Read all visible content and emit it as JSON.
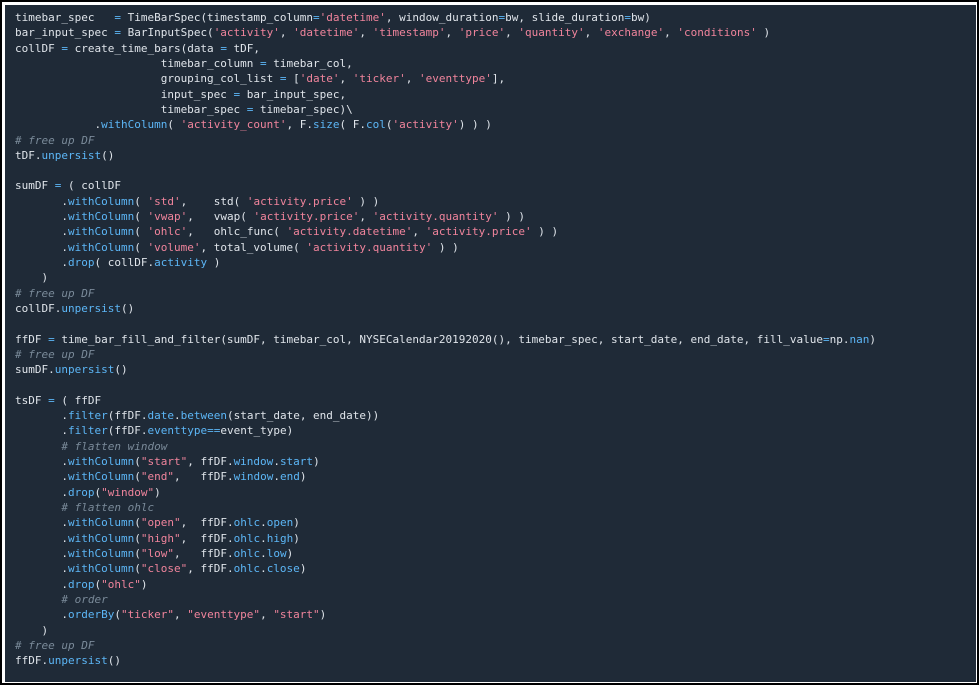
{
  "colors": {
    "background": "#1f2a37",
    "text": "#dfe4ea",
    "string": "#f0849c",
    "comment": "#7a8a99",
    "method": "#5cb6f6"
  },
  "code_lines": [
    [
      [
        "d",
        "timebar_spec   "
      ],
      [
        "o",
        "="
      ],
      [
        "d",
        " TimeBarSpec(timestamp_column"
      ],
      [
        "o",
        "="
      ],
      [
        "s",
        "'datetime'"
      ],
      [
        "d",
        ", window_duration"
      ],
      [
        "o",
        "="
      ],
      [
        "d",
        "bw, slide_duration"
      ],
      [
        "o",
        "="
      ],
      [
        "d",
        "bw)"
      ]
    ],
    [
      [
        "d",
        "bar_input_spec "
      ],
      [
        "o",
        "="
      ],
      [
        "d",
        " BarInputSpec("
      ],
      [
        "s",
        "'activity'"
      ],
      [
        "d",
        ", "
      ],
      [
        "s",
        "'datetime'"
      ],
      [
        "d",
        ", "
      ],
      [
        "s",
        "'timestamp'"
      ],
      [
        "d",
        ", "
      ],
      [
        "s",
        "'price'"
      ],
      [
        "d",
        ", "
      ],
      [
        "s",
        "'quantity'"
      ],
      [
        "d",
        ", "
      ],
      [
        "s",
        "'exchange'"
      ],
      [
        "d",
        ", "
      ],
      [
        "s",
        "'conditions'"
      ],
      [
        "d",
        " )"
      ]
    ],
    [
      [
        "d",
        "collDF "
      ],
      [
        "o",
        "="
      ],
      [
        "d",
        " create_time_bars(data "
      ],
      [
        "o",
        "="
      ],
      [
        "d",
        " tDF,"
      ]
    ],
    [
      [
        "d",
        "                      timebar_column "
      ],
      [
        "o",
        "="
      ],
      [
        "d",
        " timebar_col,"
      ]
    ],
    [
      [
        "d",
        "                      grouping_col_list "
      ],
      [
        "o",
        "="
      ],
      [
        "d",
        " ["
      ],
      [
        "s",
        "'date'"
      ],
      [
        "d",
        ", "
      ],
      [
        "s",
        "'ticker'"
      ],
      [
        "d",
        ", "
      ],
      [
        "s",
        "'eventtype'"
      ],
      [
        "d",
        "],"
      ]
    ],
    [
      [
        "d",
        "                      input_spec "
      ],
      [
        "o",
        "="
      ],
      [
        "d",
        " bar_input_spec,"
      ]
    ],
    [
      [
        "d",
        "                      timebar_spec "
      ],
      [
        "o",
        "="
      ],
      [
        "d",
        " timebar_spec)\\"
      ]
    ],
    [
      [
        "d",
        "            ."
      ],
      [
        "m",
        "withColumn"
      ],
      [
        "d",
        "( "
      ],
      [
        "s",
        "'activity_count'"
      ],
      [
        "d",
        ", F."
      ],
      [
        "m",
        "size"
      ],
      [
        "d",
        "( F."
      ],
      [
        "m",
        "col"
      ],
      [
        "d",
        "("
      ],
      [
        "s",
        "'activity'"
      ],
      [
        "d",
        ") ) )"
      ]
    ],
    [
      [
        "c",
        "# free up DF"
      ]
    ],
    [
      [
        "d",
        "tDF."
      ],
      [
        "m",
        "unpersist"
      ],
      [
        "d",
        "()"
      ]
    ],
    [
      [
        "d",
        ""
      ]
    ],
    [
      [
        "d",
        "sumDF "
      ],
      [
        "o",
        "="
      ],
      [
        "d",
        " ( collDF"
      ]
    ],
    [
      [
        "d",
        "       ."
      ],
      [
        "m",
        "withColumn"
      ],
      [
        "d",
        "( "
      ],
      [
        "s",
        "'std'"
      ],
      [
        "d",
        ",    std( "
      ],
      [
        "s",
        "'activity.price'"
      ],
      [
        "d",
        " ) )"
      ]
    ],
    [
      [
        "d",
        "       ."
      ],
      [
        "m",
        "withColumn"
      ],
      [
        "d",
        "( "
      ],
      [
        "s",
        "'vwap'"
      ],
      [
        "d",
        ",   vwap( "
      ],
      [
        "s",
        "'activity.price'"
      ],
      [
        "d",
        ", "
      ],
      [
        "s",
        "'activity.quantity'"
      ],
      [
        "d",
        " ) )"
      ]
    ],
    [
      [
        "d",
        "       ."
      ],
      [
        "m",
        "withColumn"
      ],
      [
        "d",
        "( "
      ],
      [
        "s",
        "'ohlc'"
      ],
      [
        "d",
        ",   ohlc_func( "
      ],
      [
        "s",
        "'activity.datetime'"
      ],
      [
        "d",
        ", "
      ],
      [
        "s",
        "'activity.price'"
      ],
      [
        "d",
        " ) )"
      ]
    ],
    [
      [
        "d",
        "       ."
      ],
      [
        "m",
        "withColumn"
      ],
      [
        "d",
        "( "
      ],
      [
        "s",
        "'volume'"
      ],
      [
        "d",
        ", total_volume( "
      ],
      [
        "s",
        "'activity.quantity'"
      ],
      [
        "d",
        " ) )"
      ]
    ],
    [
      [
        "d",
        "       ."
      ],
      [
        "m",
        "drop"
      ],
      [
        "d",
        "( collDF."
      ],
      [
        "m",
        "activity"
      ],
      [
        "d",
        " )"
      ]
    ],
    [
      [
        "d",
        "    )"
      ]
    ],
    [
      [
        "c",
        "# free up DF"
      ]
    ],
    [
      [
        "d",
        "collDF."
      ],
      [
        "m",
        "unpersist"
      ],
      [
        "d",
        "()"
      ]
    ],
    [
      [
        "d",
        ""
      ]
    ],
    [
      [
        "d",
        "ffDF "
      ],
      [
        "o",
        "="
      ],
      [
        "d",
        " time_bar_fill_and_filter(sumDF, timebar_col, NYSECalendar20192020(), timebar_spec, start_date, end_date, fill_value"
      ],
      [
        "o",
        "="
      ],
      [
        "d",
        "np."
      ],
      [
        "m",
        "nan"
      ],
      [
        "d",
        ")"
      ]
    ],
    [
      [
        "c",
        "# free up DF"
      ]
    ],
    [
      [
        "d",
        "sumDF."
      ],
      [
        "m",
        "unpersist"
      ],
      [
        "d",
        "()"
      ]
    ],
    [
      [
        "d",
        ""
      ]
    ],
    [
      [
        "d",
        "tsDF "
      ],
      [
        "o",
        "="
      ],
      [
        "d",
        " ( ffDF"
      ]
    ],
    [
      [
        "d",
        "       ."
      ],
      [
        "m",
        "filter"
      ],
      [
        "d",
        "(ffDF."
      ],
      [
        "m",
        "date"
      ],
      [
        "d",
        "."
      ],
      [
        "m",
        "between"
      ],
      [
        "d",
        "(start_date, end_date))"
      ]
    ],
    [
      [
        "d",
        "       ."
      ],
      [
        "m",
        "filter"
      ],
      [
        "d",
        "(ffDF."
      ],
      [
        "m",
        "eventtype"
      ],
      [
        "o",
        "=="
      ],
      [
        "d",
        "event_type)"
      ]
    ],
    [
      [
        "c",
        "       # flatten window"
      ]
    ],
    [
      [
        "d",
        "       ."
      ],
      [
        "m",
        "withColumn"
      ],
      [
        "d",
        "("
      ],
      [
        "s",
        "\"start\""
      ],
      [
        "d",
        ", ffDF."
      ],
      [
        "m",
        "window"
      ],
      [
        "d",
        "."
      ],
      [
        "m",
        "start"
      ],
      [
        "d",
        ")"
      ]
    ],
    [
      [
        "d",
        "       ."
      ],
      [
        "m",
        "withColumn"
      ],
      [
        "d",
        "("
      ],
      [
        "s",
        "\"end\""
      ],
      [
        "d",
        ",   ffDF."
      ],
      [
        "m",
        "window"
      ],
      [
        "d",
        "."
      ],
      [
        "m",
        "end"
      ],
      [
        "d",
        ")"
      ]
    ],
    [
      [
        "d",
        "       ."
      ],
      [
        "m",
        "drop"
      ],
      [
        "d",
        "("
      ],
      [
        "s",
        "\"window\""
      ],
      [
        "d",
        ")"
      ]
    ],
    [
      [
        "c",
        "       # flatten ohlc"
      ]
    ],
    [
      [
        "d",
        "       ."
      ],
      [
        "m",
        "withColumn"
      ],
      [
        "d",
        "("
      ],
      [
        "s",
        "\"open\""
      ],
      [
        "d",
        ",  ffDF."
      ],
      [
        "m",
        "ohlc"
      ],
      [
        "d",
        "."
      ],
      [
        "m",
        "open"
      ],
      [
        "d",
        ")"
      ]
    ],
    [
      [
        "d",
        "       ."
      ],
      [
        "m",
        "withColumn"
      ],
      [
        "d",
        "("
      ],
      [
        "s",
        "\"high\""
      ],
      [
        "d",
        ",  ffDF."
      ],
      [
        "m",
        "ohlc"
      ],
      [
        "d",
        "."
      ],
      [
        "m",
        "high"
      ],
      [
        "d",
        ")"
      ]
    ],
    [
      [
        "d",
        "       ."
      ],
      [
        "m",
        "withColumn"
      ],
      [
        "d",
        "("
      ],
      [
        "s",
        "\"low\""
      ],
      [
        "d",
        ",   ffDF."
      ],
      [
        "m",
        "ohlc"
      ],
      [
        "d",
        "."
      ],
      [
        "m",
        "low"
      ],
      [
        "d",
        ")"
      ]
    ],
    [
      [
        "d",
        "       ."
      ],
      [
        "m",
        "withColumn"
      ],
      [
        "d",
        "("
      ],
      [
        "s",
        "\"close\""
      ],
      [
        "d",
        ", ffDF."
      ],
      [
        "m",
        "ohlc"
      ],
      [
        "d",
        "."
      ],
      [
        "m",
        "close"
      ],
      [
        "d",
        ")"
      ]
    ],
    [
      [
        "d",
        "       ."
      ],
      [
        "m",
        "drop"
      ],
      [
        "d",
        "("
      ],
      [
        "s",
        "\"ohlc\""
      ],
      [
        "d",
        ")"
      ]
    ],
    [
      [
        "c",
        "       # order"
      ]
    ],
    [
      [
        "d",
        "       ."
      ],
      [
        "m",
        "orderBy"
      ],
      [
        "d",
        "("
      ],
      [
        "s",
        "\"ticker\""
      ],
      [
        "d",
        ", "
      ],
      [
        "s",
        "\"eventtype\""
      ],
      [
        "d",
        ", "
      ],
      [
        "s",
        "\"start\""
      ],
      [
        "d",
        ")"
      ]
    ],
    [
      [
        "d",
        "    )"
      ]
    ],
    [
      [
        "c",
        "# free up DF"
      ]
    ],
    [
      [
        "d",
        "ffDF."
      ],
      [
        "m",
        "unpersist"
      ],
      [
        "d",
        "()"
      ]
    ]
  ]
}
